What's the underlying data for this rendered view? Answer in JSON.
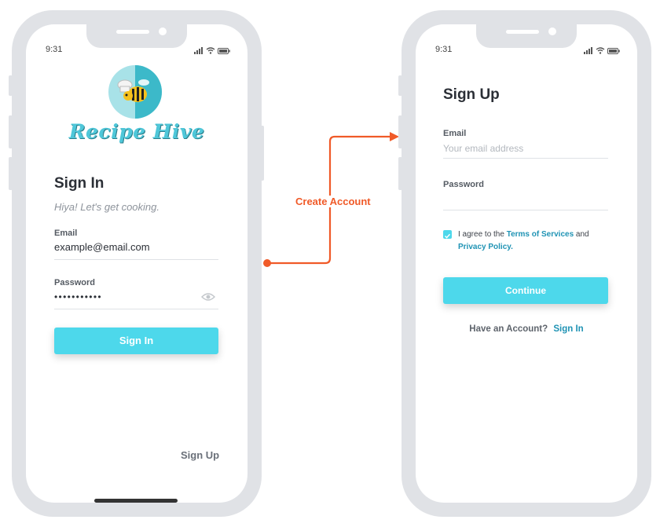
{
  "colors": {
    "accent": "#4dd8eb",
    "arrow": "#f05a28",
    "link": "#1f93b4",
    "frame": "#e0e2e6"
  },
  "signin_screen": {
    "status_time": "9:31",
    "brand": "Recipe Hive",
    "title": "Sign In",
    "subtitle": "Hiya! Let's get cooking.",
    "email_label": "Email",
    "email_value": "example@email.com",
    "password_label": "Password",
    "password_value": "• • • • • • • • • • •",
    "signin_button": "Sign In",
    "signup_link": "Sign Up",
    "icons": {
      "eye": "eye-icon"
    }
  },
  "flow": {
    "label": "Create Account"
  },
  "signup_screen": {
    "status_time": "9:31",
    "title": "Sign Up",
    "email_label": "Email",
    "email_placeholder": "Your email address",
    "password_label": "Password",
    "agree_prefix": "I agree to the",
    "terms_link": "Terms of Services",
    "agree_and": "and",
    "privacy_link": "Privacy Policy.",
    "terms_checked": true,
    "continue_button": "Continue",
    "have_account": "Have an Account?",
    "signin_link": "Sign In"
  }
}
